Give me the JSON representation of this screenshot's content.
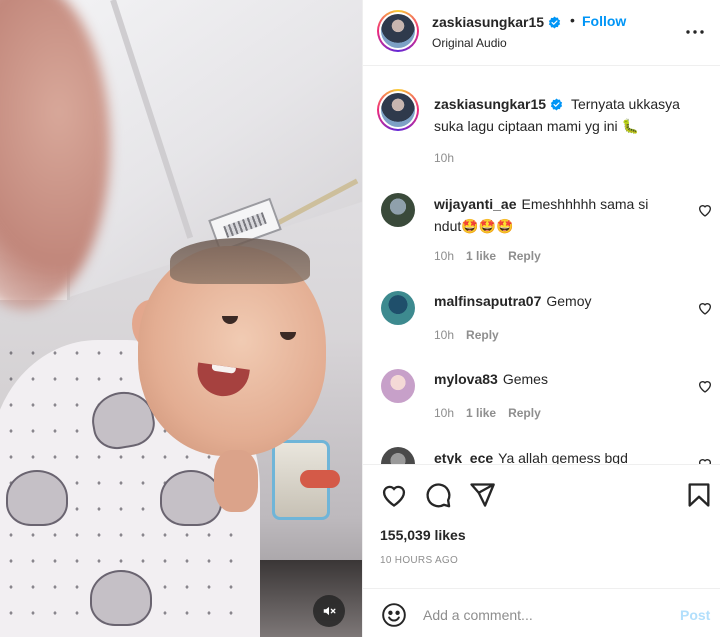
{
  "post": {
    "username": "zaskiasungkar15",
    "verified": true,
    "follow_label": "Follow",
    "separator": "•",
    "audio": "Original Audio",
    "more_icon": "more-horizontal-icon"
  },
  "caption": {
    "username": "zaskiasungkar15",
    "text": "Ternyata ukkasya suka lagu ciptaan mami yg ini 🐛",
    "time": "10h"
  },
  "comments": [
    {
      "username": "wijayanti_ae",
      "text": "Emeshhhhh sama si ndut🤩🤩🤩",
      "time": "10h",
      "likes": "1 like",
      "reply": "Reply",
      "avatar_color": "#3a4a3a"
    },
    {
      "username": "malfinsaputra07",
      "text": "Gemoy",
      "time": "10h",
      "likes": "",
      "reply": "Reply",
      "avatar_color": "#3d8a8f"
    },
    {
      "username": "mylova83",
      "text": "Gemes",
      "time": "10h",
      "likes": "1 like",
      "reply": "Reply",
      "avatar_color": "#c7a0c9"
    },
    {
      "username": "etyk_ece",
      "text": "Ya allah gemess bgd",
      "time": "",
      "likes": "",
      "reply": "",
      "avatar_color": "#4a4a4a"
    }
  ],
  "stats": {
    "likes": "155,039 likes",
    "time_ago": "10 HOURS AGO"
  },
  "add_comment": {
    "placeholder": "Add a comment...",
    "post_label": "Post"
  },
  "colors": {
    "accent": "#0095f6",
    "post_disabled": "#b2dffc",
    "muted_text": "#8e8e8e"
  }
}
